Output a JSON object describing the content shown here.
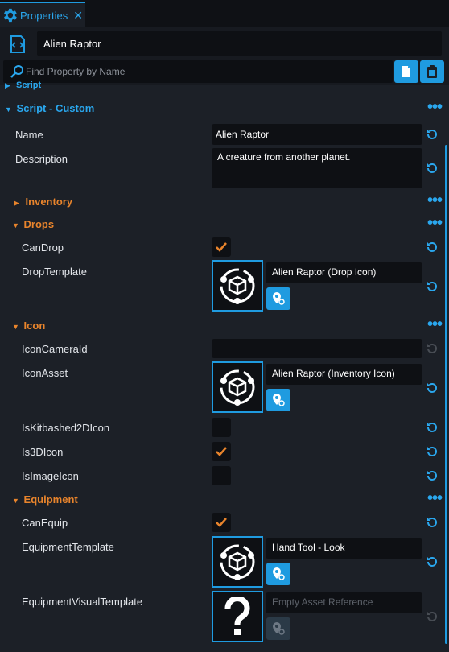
{
  "tab": {
    "label": "Properties",
    "close": "✕",
    "icon": "gear-icon"
  },
  "header": {
    "object_icon": "script-icon",
    "object_name": "Alien Raptor",
    "search_placeholder": "Find Property by Name",
    "search_icon": "search-icon",
    "copy_icon": "copy-icon",
    "paste_icon": "paste-icon"
  },
  "sections": {
    "script": {
      "label": "Script"
    },
    "script_custom": {
      "label": "Script - Custom"
    },
    "inventory": {
      "label": "Inventory"
    },
    "drops": {
      "label": "Drops"
    },
    "icon": {
      "label": "Icon"
    },
    "equipment": {
      "label": "Equipment"
    }
  },
  "props": {
    "name": {
      "label": "Name",
      "value": "Alien Raptor"
    },
    "description": {
      "label": "Description",
      "value": "A creature from another planet."
    },
    "can_drop": {
      "label": "CanDrop",
      "checked": true
    },
    "drop_template": {
      "label": "DropTemplate",
      "asset": "Alien Raptor (Drop Icon)"
    },
    "icon_camera_id": {
      "label": "IconCameraId",
      "value": ""
    },
    "icon_asset": {
      "label": "IconAsset",
      "asset": "Alien Raptor (Inventory Icon)"
    },
    "is_kitbashed": {
      "label": "IsKitbashed2DIcon",
      "checked": false
    },
    "is_3d_icon": {
      "label": "Is3DIcon",
      "checked": true
    },
    "is_image_icon": {
      "label": "IsImageIcon",
      "checked": false
    },
    "can_equip": {
      "label": "CanEquip",
      "checked": true
    },
    "equipment_template": {
      "label": "EquipmentTemplate",
      "asset": "Hand Tool - Look"
    },
    "equipment_visual_template": {
      "label": "EquipmentVisualTemplate",
      "asset_placeholder": "Empty Asset Reference"
    }
  },
  "colors": {
    "accent": "#1f9be0",
    "section_orange": "#e8842c",
    "section_blue": "#2aa7ee",
    "checkmark": "#e8842c"
  },
  "icons": {
    "more": "ellipsis-icon",
    "reset": "reset-icon",
    "check": "check-icon",
    "template": "template-icon",
    "unknown": "question-icon",
    "locate": "locate-icon"
  }
}
